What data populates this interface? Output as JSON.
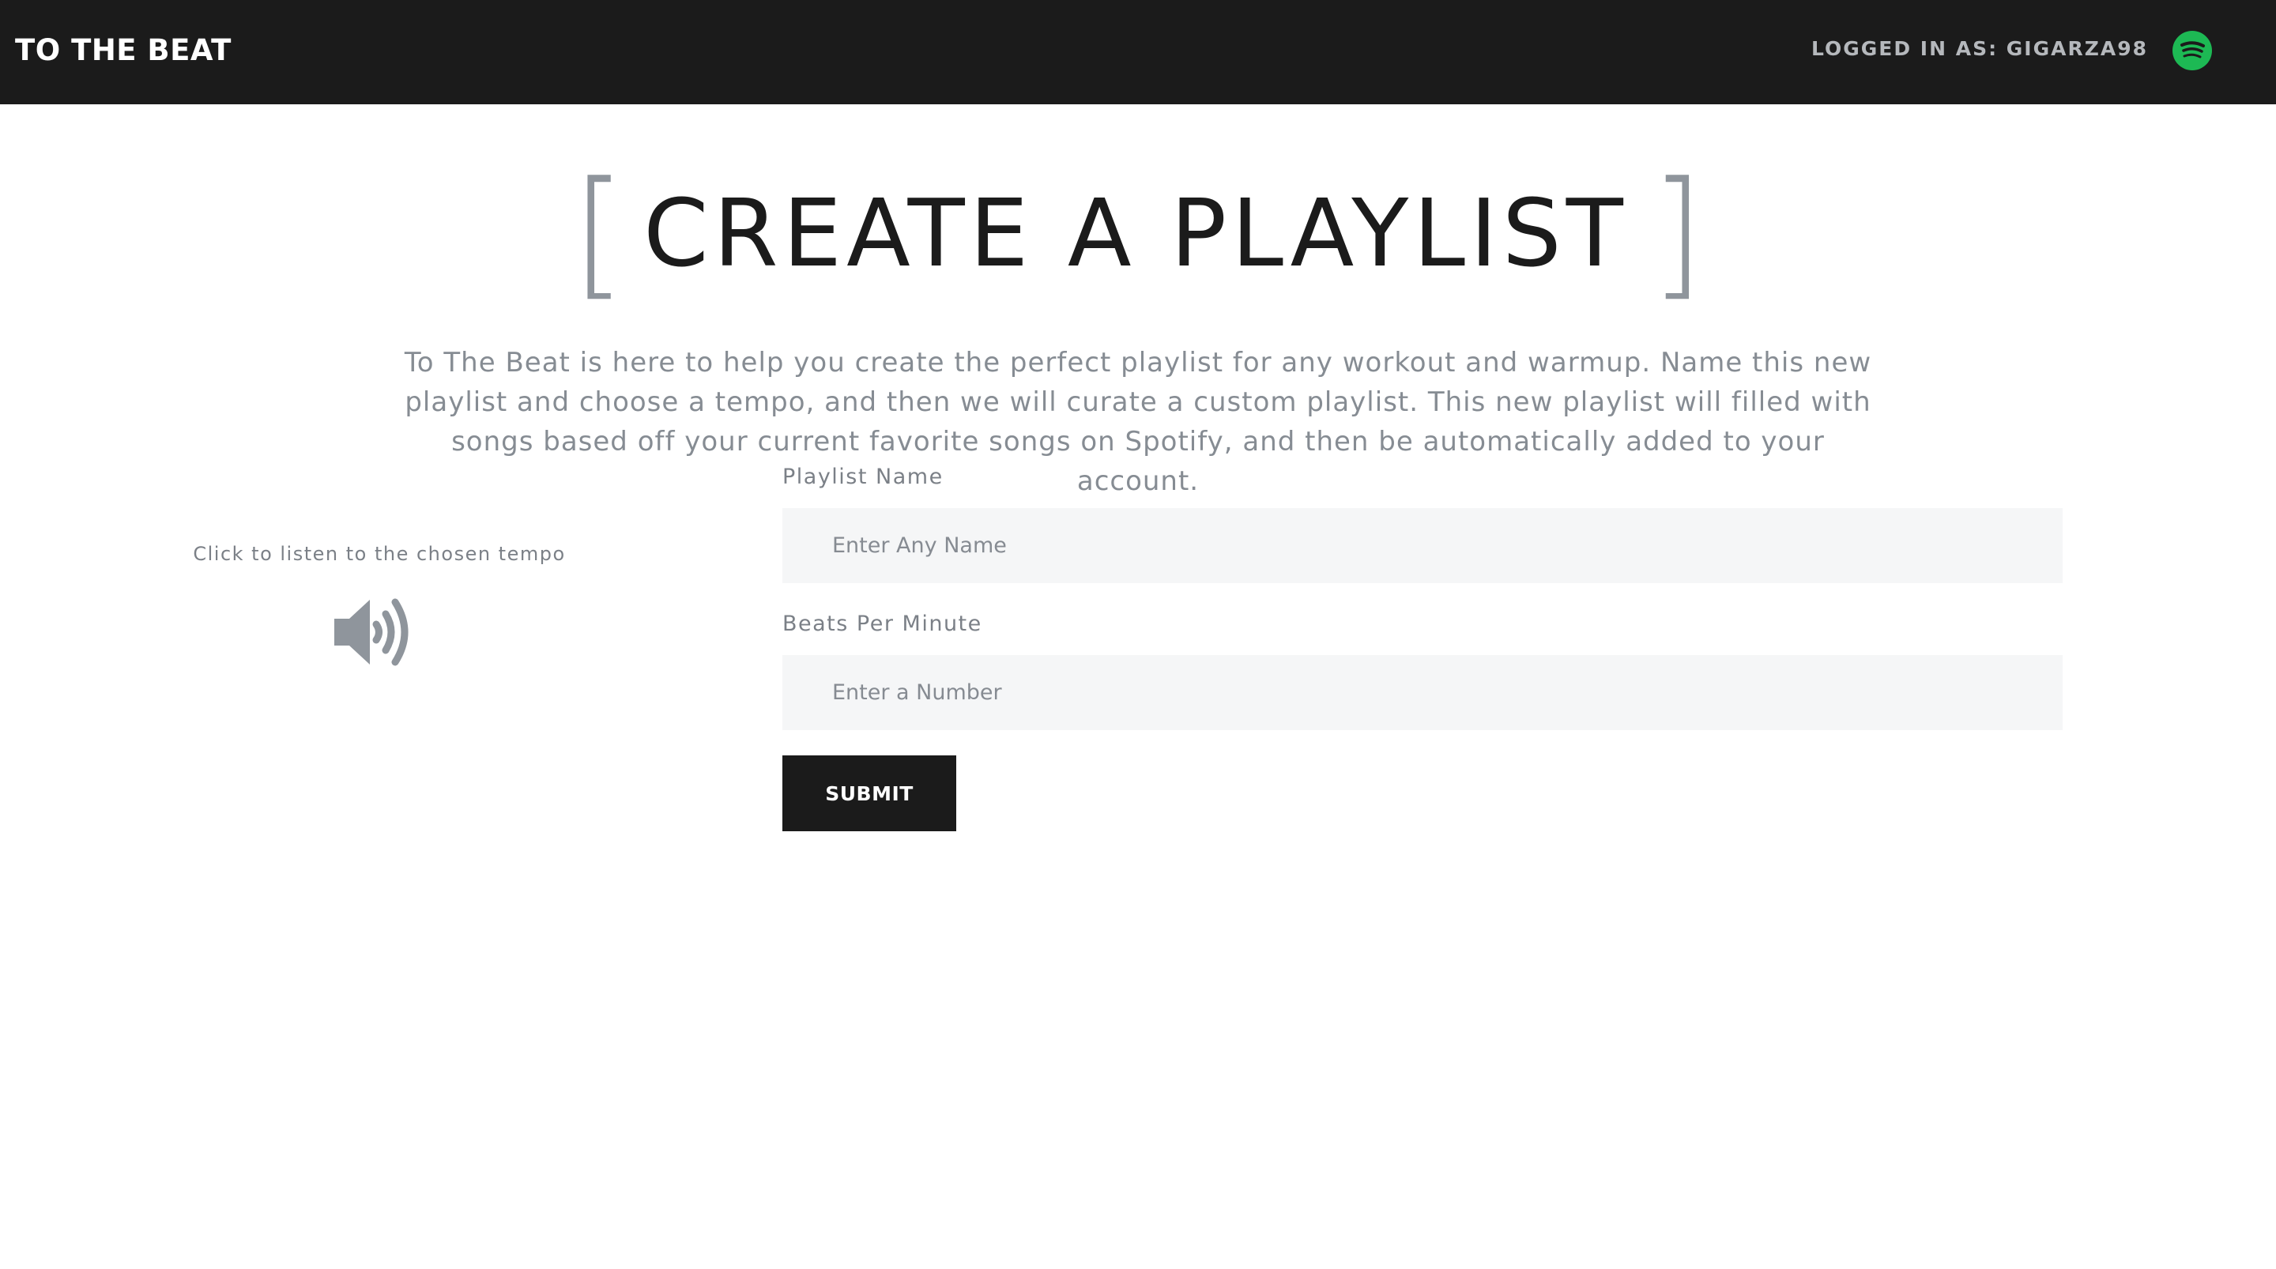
{
  "navbar": {
    "brand": "TO THE BEAT",
    "user_text": "LOGGED IN AS: GIGARZA98",
    "icon": "spotify-icon",
    "spotify_color": "#1db954"
  },
  "hero": {
    "bracket_left": "[",
    "title": "CREATE A PLAYLIST",
    "bracket_right": "]",
    "description": "To The Beat is here to help you create the perfect playlist for any workout and warmup. Name this new playlist and choose a tempo, and then we will curate a custom playlist. This new playlist will filled with songs based off your current favorite songs on Spotify, and then be automatically added to your account."
  },
  "tempo": {
    "label": "Click to listen to the chosen tempo",
    "icon": "speaker-volume-icon"
  },
  "form": {
    "name_label": "Playlist Name",
    "name_placeholder": "Enter Any Name",
    "name_value": "",
    "bpm_label": "Beats Per Minute",
    "bpm_placeholder": "Enter a Number",
    "bpm_value": "",
    "submit_label": "SUBMIT"
  },
  "colors": {
    "navbar_bg": "#1b1b1b",
    "accent_gray": "#8f959c",
    "field_bg": "#f5f6f7",
    "button_bg": "#1b1b1b"
  }
}
